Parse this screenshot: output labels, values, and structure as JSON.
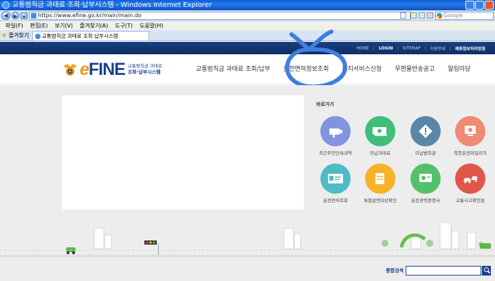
{
  "window": {
    "title": "교통범칙금 과태료 조회·납부시스템 - Windows Internet Explorer"
  },
  "address_bar": {
    "url": "https://www.efine.go.kr/main/main.do",
    "search_placeholder": "Google"
  },
  "menu": {
    "items": [
      "파일(F)",
      "편집(E)",
      "보기(V)",
      "즐겨찾기(A)",
      "도구(T)",
      "도움말(H)"
    ]
  },
  "tabs": {
    "favorites_label": "즐겨찾기",
    "active_tab": "교통범칙금 과태료 조회·납부시스템"
  },
  "utility_links": [
    "HOME",
    "LOGIN",
    "SITEMAP",
    "이용안내",
    "제휴정보처리방침"
  ],
  "logo": {
    "brand_e": "e",
    "brand_rest": "FINE",
    "sub_line1": "교통범칙금 과태료",
    "sub_line2": "조회·납부시스템"
  },
  "main_nav": [
    "교통범칙금 과태료 조회/납부",
    "운전면허정보조회",
    "통지서비스신청",
    "우편물반송공고",
    "알림마당"
  ],
  "quick_links": {
    "title": "바로가기",
    "items": [
      {
        "label": "최근무인단속내역",
        "color": "#7f95e0",
        "icon": "camera-icon"
      },
      {
        "label": "미납과태료",
        "color": "#3fbf7a",
        "icon": "money-icon"
      },
      {
        "label": "미납범칙금",
        "color": "#5a86a8",
        "icon": "warning-icon"
      },
      {
        "label": "착한운전마일리지",
        "color": "#f08a73",
        "icon": "monitor-icon"
      },
      {
        "label": "운전면허조회",
        "color": "#4fbac8",
        "icon": "license-card-icon"
      },
      {
        "label": "특별감면대상확인",
        "color": "#f7b325",
        "icon": "document-icon"
      },
      {
        "label": "운전경력증명서",
        "color": "#55c06a",
        "icon": "certificate-icon"
      },
      {
        "label": "교통사고확인원",
        "color": "#e0574a",
        "icon": "car-crash-icon"
      }
    ]
  },
  "search": {
    "label": "통합검색",
    "value": ""
  },
  "colors": {
    "brand_navy": "#1b3f90",
    "brand_orange": "#f29a1a",
    "annotation_blue": "#3d7fe0"
  }
}
